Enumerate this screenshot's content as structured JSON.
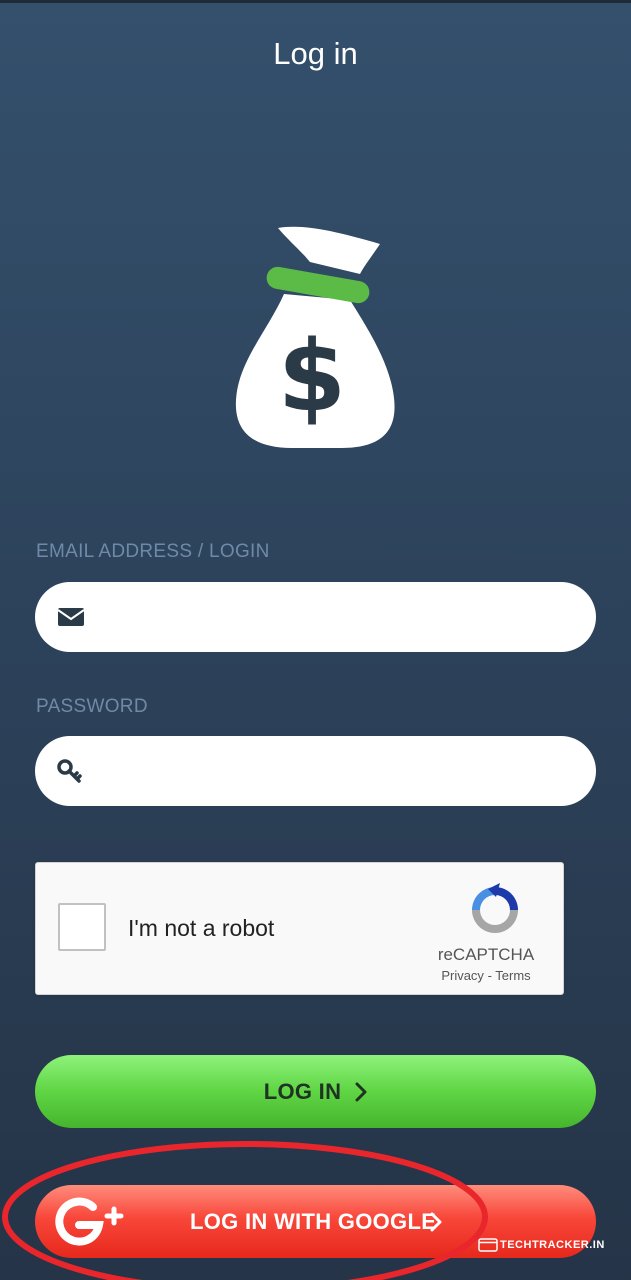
{
  "header": {
    "title": "Log in"
  },
  "logo": {
    "icon": "money-bag-icon",
    "symbol": "$",
    "band_color": "#5cba47"
  },
  "form": {
    "email": {
      "label": "EMAIL ADDRESS / LOGIN",
      "value": "",
      "placeholder": "",
      "icon": "envelope-icon"
    },
    "password": {
      "label": "PASSWORD",
      "value": "",
      "placeholder": "",
      "icon": "key-icon"
    }
  },
  "captcha": {
    "checkbox_label": "I'm not a robot",
    "brand": "reCAPTCHA",
    "privacy": "Privacy",
    "separator": "-",
    "terms": "Terms"
  },
  "buttons": {
    "login": {
      "label": "LOG IN",
      "color": "#5fd544"
    },
    "google": {
      "label": "LOG IN WITH GOOGLE",
      "icon": "google-plus-icon",
      "color": "#f8473a"
    }
  },
  "annotation": {
    "color": "#e8262b"
  },
  "watermark": {
    "text": "TECHTRACKER.IN"
  }
}
